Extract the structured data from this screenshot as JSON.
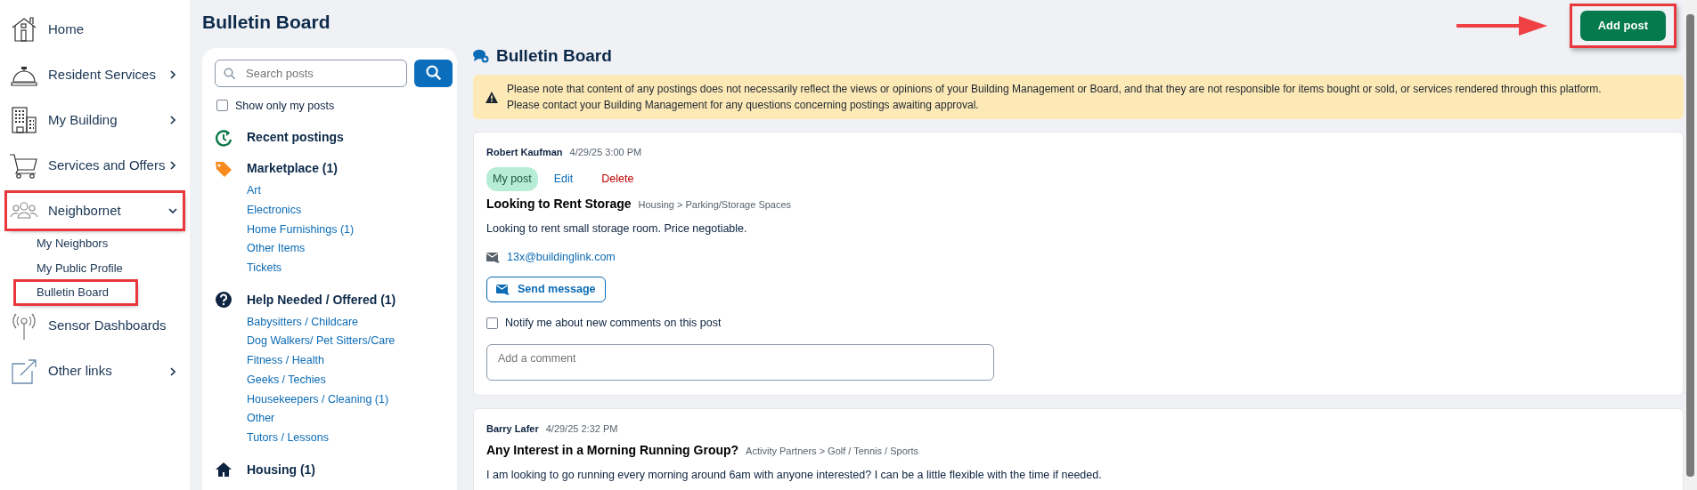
{
  "sidebar": {
    "items": [
      {
        "label": "Home",
        "highlighted": false
      },
      {
        "label": "Resident Services",
        "expanded": false,
        "highlighted": false
      },
      {
        "label": "My Building",
        "expanded": false,
        "highlighted": false
      },
      {
        "label": "Services and Offers",
        "expanded": false,
        "highlighted": false
      },
      {
        "label": "Neighbornet",
        "expanded": true,
        "highlighted": true,
        "children": [
          {
            "label": "My Neighbors",
            "highlighted": false
          },
          {
            "label": "My Public Profile",
            "highlighted": false
          },
          {
            "label": "Bulletin Board",
            "highlighted": true
          }
        ]
      },
      {
        "label": "Sensor Dashboards",
        "highlighted": false
      },
      {
        "label": "Other links",
        "expanded": false,
        "highlighted": false
      }
    ]
  },
  "header": {
    "title": "Bulletin Board",
    "add_button": {
      "label": "Add post",
      "highlighted": true
    }
  },
  "filters": {
    "search": {
      "placeholder": "Search posts"
    },
    "only_mine": {
      "label": "Show only my posts",
      "checked": false
    },
    "categories": [
      {
        "label": "Recent postings"
      },
      {
        "label": "Marketplace (1)",
        "children": [
          {
            "label": "Art"
          },
          {
            "label": "Electronics"
          },
          {
            "label": "Home Furnishings (1)"
          },
          {
            "label": "Other Items"
          },
          {
            "label": "Tickets"
          }
        ]
      },
      {
        "label": "Help Needed / Offered (1)",
        "children": [
          {
            "label": "Babysitters / Childcare"
          },
          {
            "label": "Dog Walkers/ Pet Sitters/Care"
          },
          {
            "label": "Fitness / Health"
          },
          {
            "label": "Geeks / Techies"
          },
          {
            "label": "Housekeepers / Cleaning (1)"
          },
          {
            "label": "Other"
          },
          {
            "label": "Tutors / Lessons"
          }
        ]
      },
      {
        "label": "Housing (1)"
      }
    ]
  },
  "board": {
    "title": "Bulletin Board",
    "notice": [
      "Please note that content of any postings does not necessarily reflect the views or opinions of your Building Management or Board, and that they are not responsible for items bought or sold, or services rendered through this platform.",
      "Please contact your Building Management for any questions concerning postings awaiting approval."
    ],
    "posts": [
      {
        "author": "Robert Kaufman",
        "time": "4/29/25 3:00 PM",
        "own": true,
        "badge": "My post",
        "edit": "Edit",
        "delete": "Delete",
        "title": "Looking to Rent Storage",
        "category": "Housing > Parking/Storage Spaces",
        "body": "Looking to rent small storage room. Price negotiable.",
        "email": "13x@buildinglink.com",
        "send_button": "Send message",
        "notify": {
          "label": "Notify me about new comments on this post",
          "checked": false
        },
        "comment": {
          "placeholder": "Add a comment"
        }
      },
      {
        "author": "Barry Lafer",
        "time": "4/29/25 2:32 PM",
        "own": false,
        "title": "Any Interest in a Morning Running Group?",
        "category": "Activity Partners > Golf / Tennis / Sports",
        "body": "I am looking to go running every morning around 6am with anyone interested? I can be a little flexible with the time if needed."
      }
    ]
  }
}
